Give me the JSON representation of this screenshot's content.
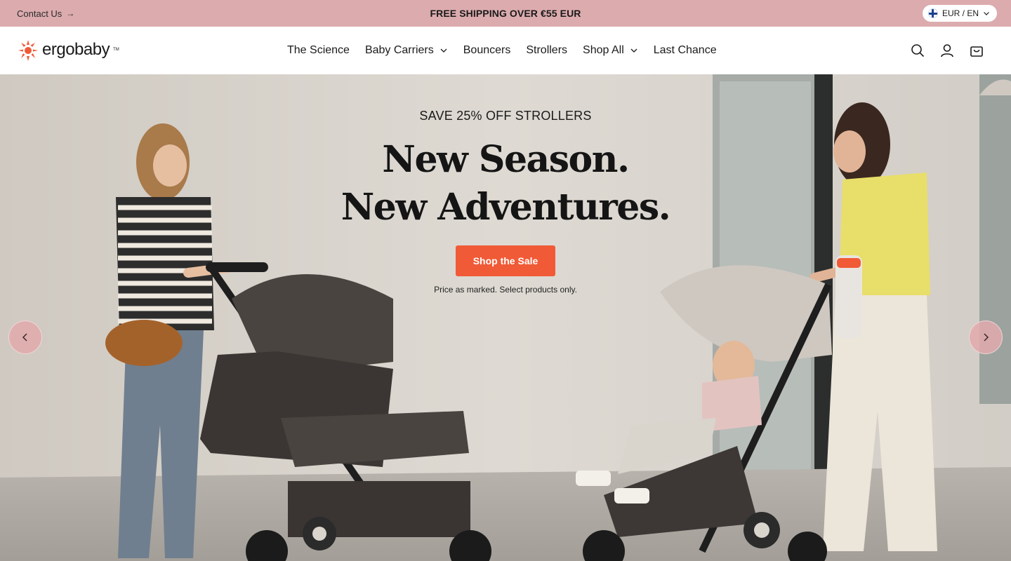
{
  "announcement": {
    "contact_label": "Contact Us",
    "shipping_text": "FREE SHIPPING OVER €55 EUR",
    "currency_label": "EUR / EN",
    "background_color": "#dcabae"
  },
  "header": {
    "logo_text": "ergobaby",
    "logo_tm": "TM",
    "nav": [
      {
        "label": "The Science",
        "has_dropdown": false
      },
      {
        "label": "Baby Carriers",
        "has_dropdown": true
      },
      {
        "label": "Bouncers",
        "has_dropdown": false
      },
      {
        "label": "Strollers",
        "has_dropdown": false
      },
      {
        "label": "Shop All",
        "has_dropdown": true
      },
      {
        "label": "Last Chance",
        "has_dropdown": false
      }
    ],
    "icons": [
      "search-icon",
      "account-icon",
      "cart-icon"
    ]
  },
  "hero": {
    "eyebrow": "SAVE 25% OFF STROLLERS",
    "headline_line1": "New Season.",
    "headline_line2": "New Adventures.",
    "cta_label": "Shop the Sale",
    "fine_print": "Price as marked. Select products only.",
    "accent_color": "#f15a36"
  }
}
